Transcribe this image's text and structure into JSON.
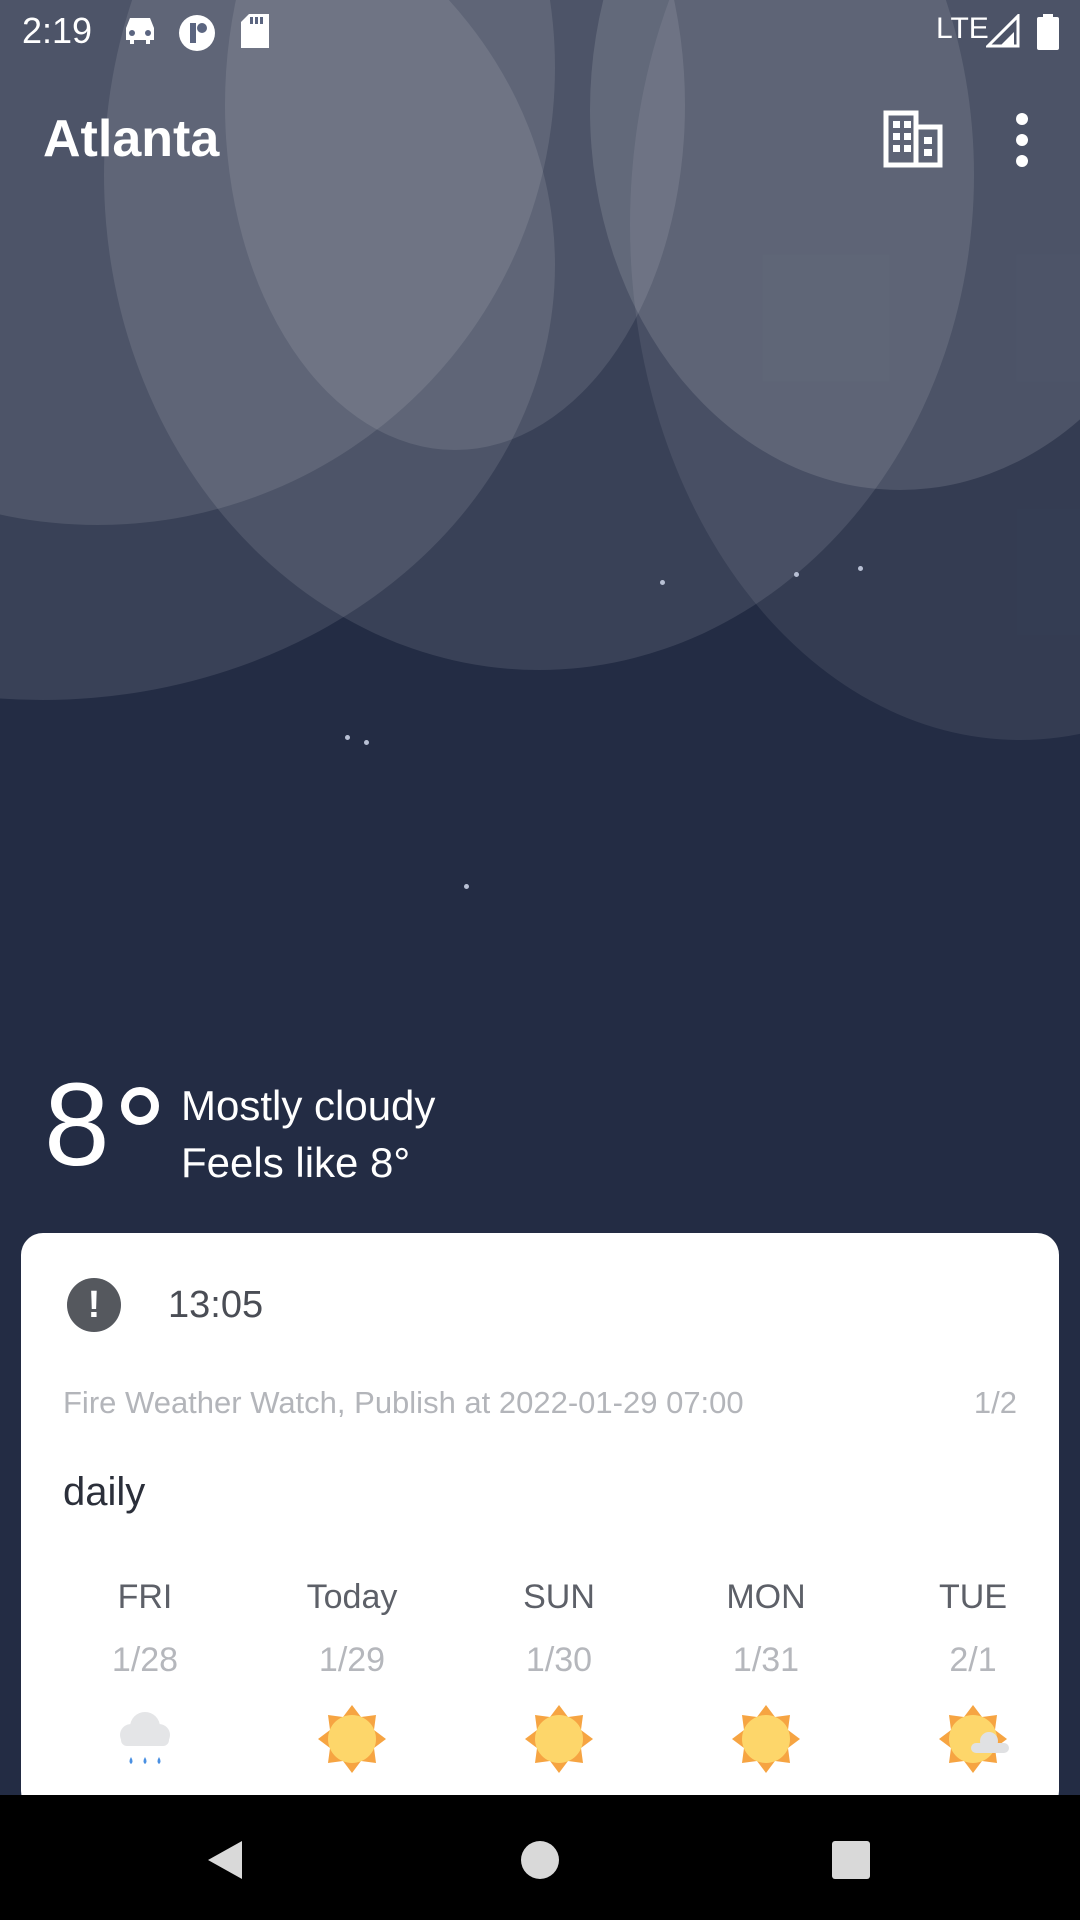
{
  "status_bar": {
    "time": "2:19",
    "network": "LTE",
    "icons": [
      "car-icon",
      "podcast-icon",
      "sd-card-icon",
      "signal-icon",
      "battery-icon"
    ]
  },
  "app_bar": {
    "city": "Atlanta",
    "actions": [
      "city-manage-icon",
      "more-vert-icon"
    ]
  },
  "current": {
    "temperature": "8",
    "condition": "Mostly cloudy",
    "feels_like": "Feels like 8°"
  },
  "alert": {
    "icon": "alert-icon",
    "time": "13:05",
    "description": "Fire Weather Watch, Publish at 2022-01-29 07:00",
    "page": "1/2"
  },
  "forecast": {
    "title": "daily",
    "days": [
      {
        "name": "FRI",
        "date": "1/28",
        "icon": "rain-icon"
      },
      {
        "name": "Today",
        "date": "1/29",
        "icon": "sun-icon"
      },
      {
        "name": "SUN",
        "date": "1/30",
        "icon": "sun-icon"
      },
      {
        "name": "MON",
        "date": "1/31",
        "icon": "sun-icon"
      },
      {
        "name": "TUE",
        "date": "2/1",
        "icon": "partly-cloudy-icon"
      }
    ]
  },
  "colors": {
    "background": "#232c44",
    "card": "#ffffff",
    "sun": "#fdd66a",
    "rain_drop": "#4a90e2"
  },
  "nav_bar": [
    "back-icon",
    "home-icon",
    "recents-icon"
  ]
}
